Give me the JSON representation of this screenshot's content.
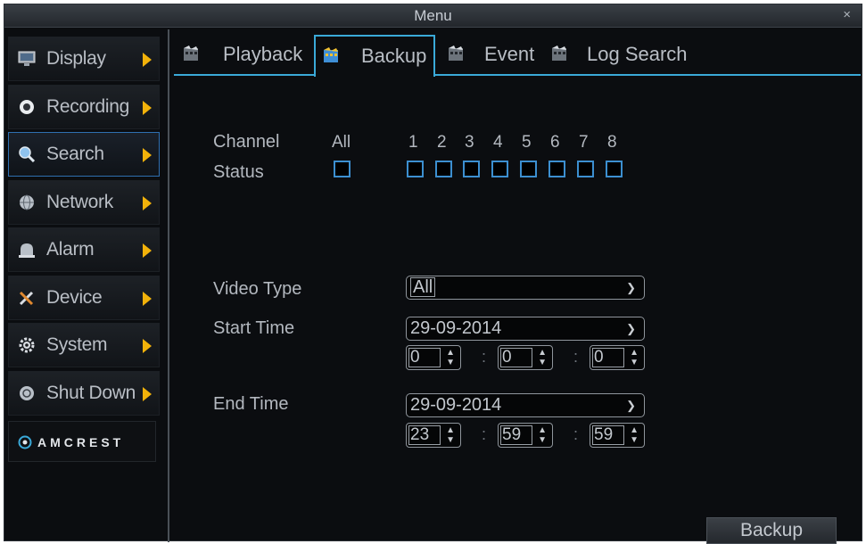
{
  "window": {
    "title": "Menu",
    "close_glyph": "×"
  },
  "sidebar": {
    "items": [
      {
        "label": "Display",
        "icon": "display-icon"
      },
      {
        "label": "Recording",
        "icon": "record-icon"
      },
      {
        "label": "Search",
        "icon": "search-icon",
        "active": true
      },
      {
        "label": "Network",
        "icon": "network-icon"
      },
      {
        "label": "Alarm",
        "icon": "alarm-icon"
      },
      {
        "label": "Device",
        "icon": "device-icon"
      },
      {
        "label": "System",
        "icon": "system-icon"
      },
      {
        "label": "Shut Down",
        "icon": "shutdown-icon"
      }
    ],
    "brand": "AMCREST"
  },
  "tabs": [
    {
      "label": "Playback",
      "icon": "film-icon"
    },
    {
      "label": "Backup",
      "icon": "film-icon",
      "active": true
    },
    {
      "label": "Event",
      "icon": "film-icon"
    },
    {
      "label": "Log Search",
      "icon": "film-icon"
    }
  ],
  "channels": {
    "channel_label": "Channel",
    "status_label": "Status",
    "all_label": "All",
    "numbers": [
      "1",
      "2",
      "3",
      "4",
      "5",
      "6",
      "7",
      "8"
    ]
  },
  "form": {
    "video_type_label": "Video Type",
    "video_type_value": "All",
    "start_time_label": "Start Time",
    "start_date": "29-09-2014",
    "start_h": "0",
    "start_m": "0",
    "start_s": "0",
    "end_time_label": "End Time",
    "end_date": "29-09-2014",
    "end_h": "23",
    "end_m": "59",
    "end_s": "59",
    "time_separator": ":"
  },
  "actions": {
    "backup_label": "Backup"
  },
  "colors": {
    "accent": "#3aa9d8",
    "arrow": "#f2b20a",
    "checkbox": "#3c8fd0"
  }
}
